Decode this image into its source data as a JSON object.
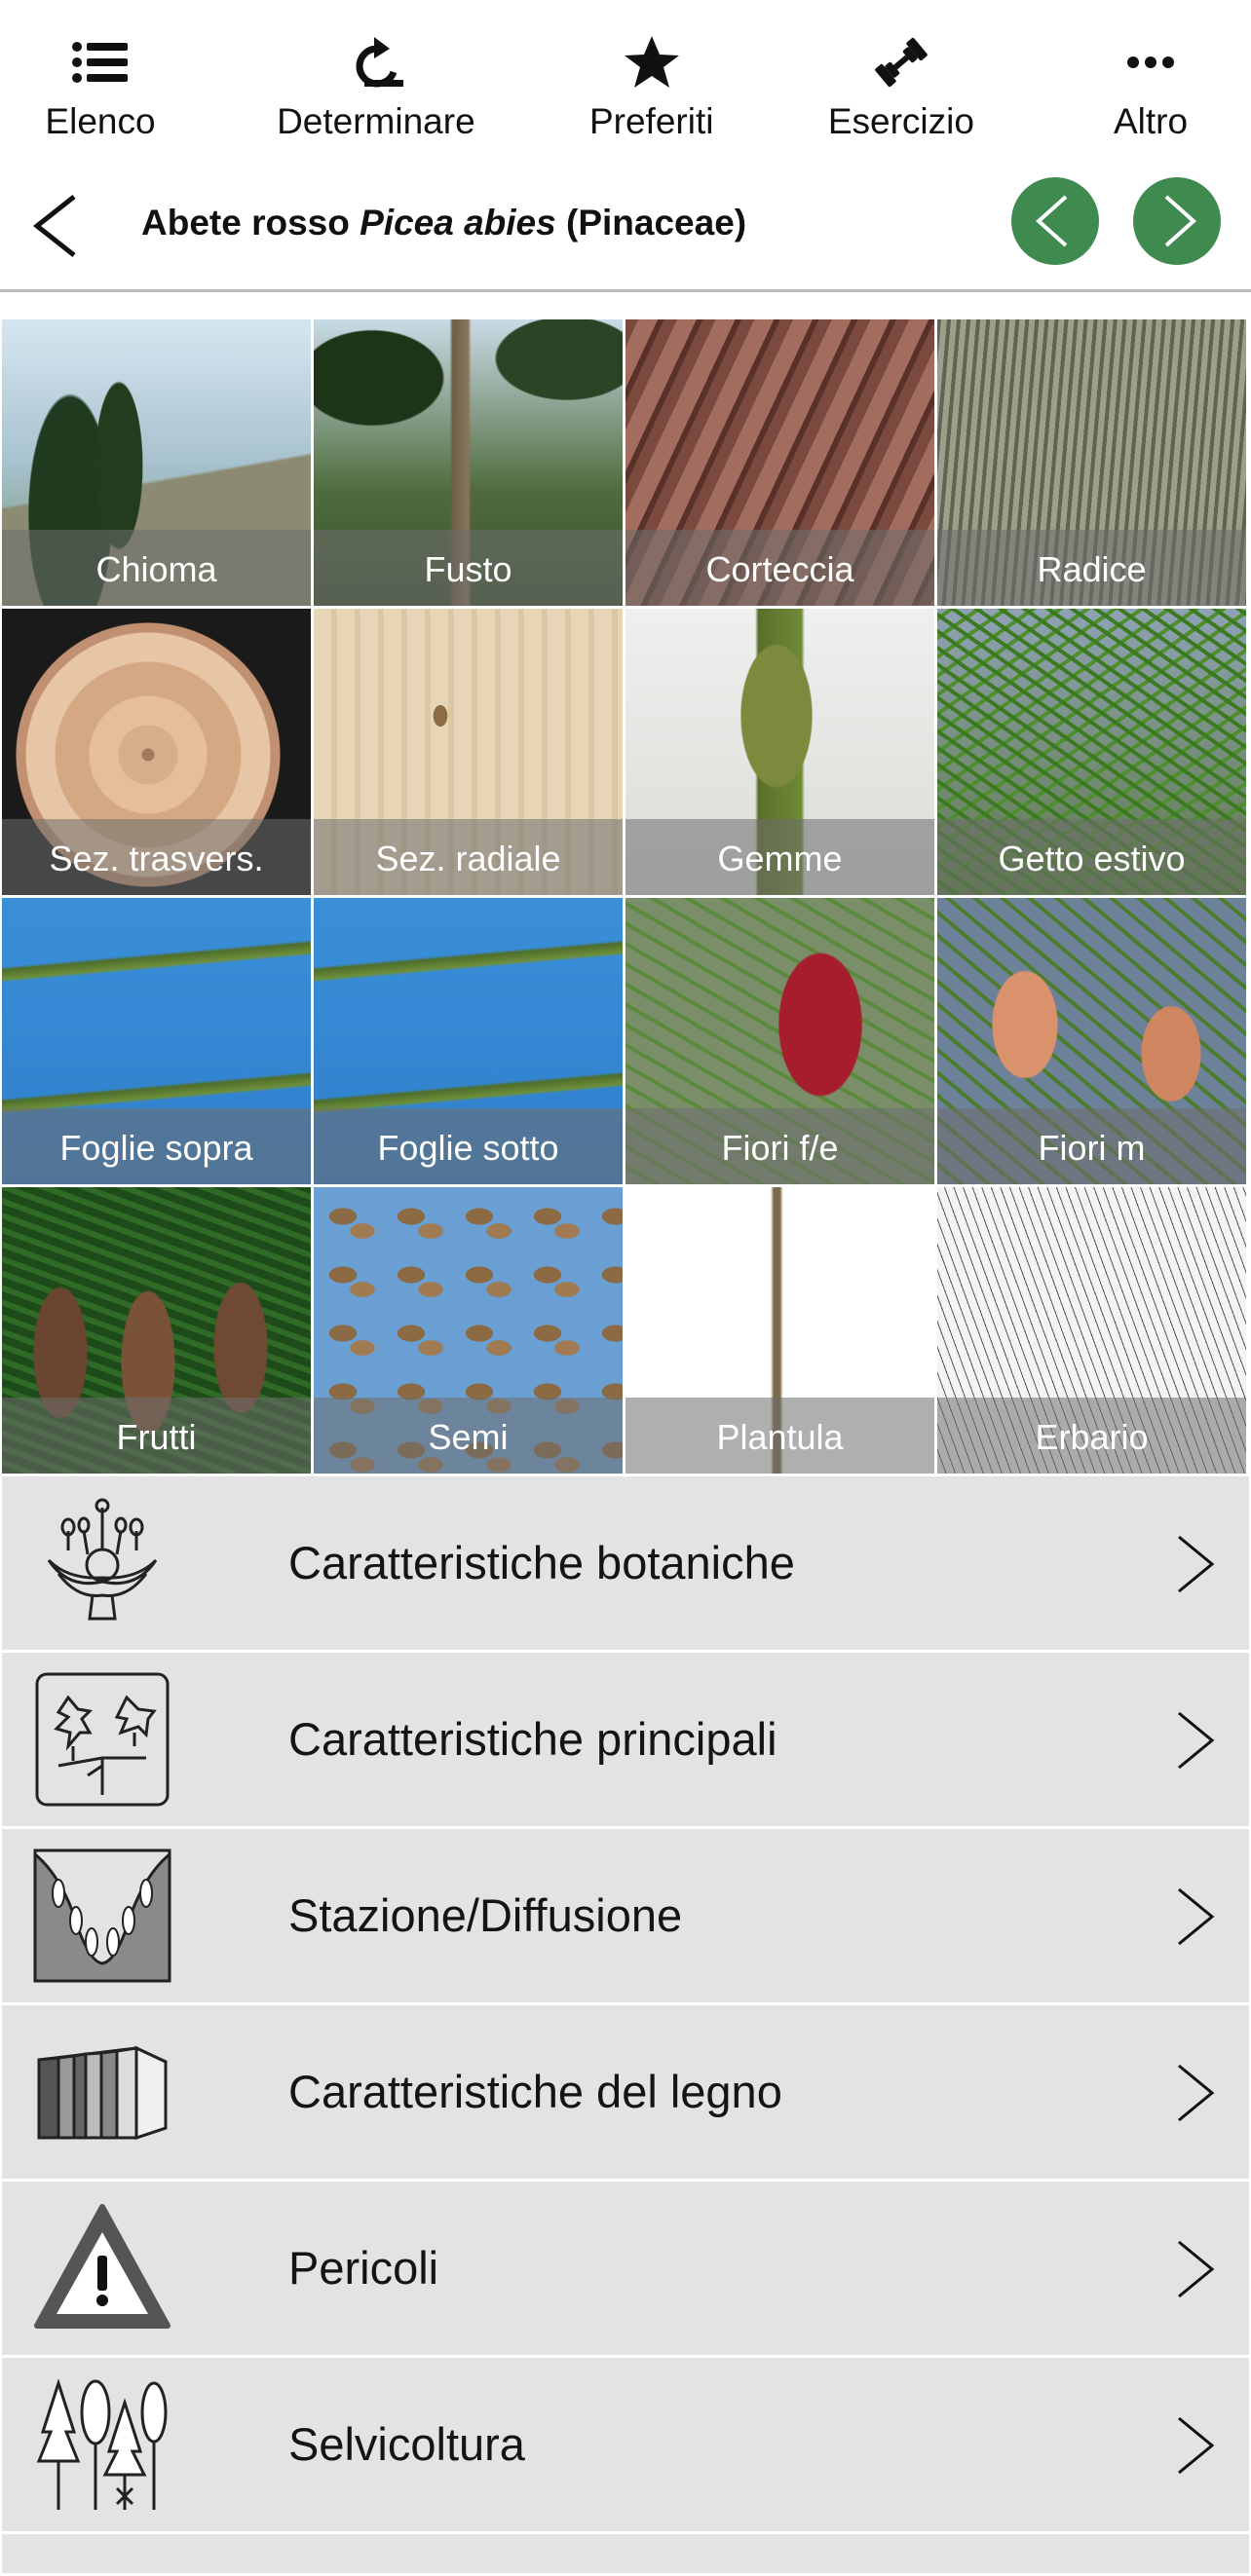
{
  "toolbar": {
    "items": [
      {
        "label": "Elenco",
        "icon": "list-icon"
      },
      {
        "label": "Determinare",
        "icon": "rotate-icon"
      },
      {
        "label": "Preferiti",
        "icon": "star-icon"
      },
      {
        "label": "Esercizio",
        "icon": "dumbbell-icon"
      },
      {
        "label": "Altro",
        "icon": "more-icon"
      }
    ]
  },
  "header": {
    "common_name": "Abete rosso",
    "scientific_name": "Picea abies",
    "family": "(Pinaceae)",
    "accent_color": "#3f8a4f"
  },
  "gallery": {
    "tiles": [
      {
        "label": "Chioma"
      },
      {
        "label": "Fusto"
      },
      {
        "label": "Corteccia"
      },
      {
        "label": "Radice"
      },
      {
        "label": "Sez. trasvers."
      },
      {
        "label": "Sez. radiale"
      },
      {
        "label": "Gemme"
      },
      {
        "label": "Getto estivo"
      },
      {
        "label": "Foglie sopra"
      },
      {
        "label": "Foglie sotto"
      },
      {
        "label": "Fiori f/e"
      },
      {
        "label": "Fiori m"
      },
      {
        "label": "Frutti"
      },
      {
        "label": "Semi"
      },
      {
        "label": "Plantula"
      },
      {
        "label": "Erbario"
      }
    ]
  },
  "sections": {
    "items": [
      {
        "label": "Caratteristiche botaniche",
        "icon": "flower-diagram-icon"
      },
      {
        "label": "Caratteristiche principali",
        "icon": "leaves-icon"
      },
      {
        "label": "Stazione/Diffusione",
        "icon": "valley-icon"
      },
      {
        "label": "Caratteristiche del legno",
        "icon": "wood-block-icon"
      },
      {
        "label": "Pericoli",
        "icon": "warning-icon"
      },
      {
        "label": "Selvicoltura",
        "icon": "trees-icon"
      }
    ]
  }
}
